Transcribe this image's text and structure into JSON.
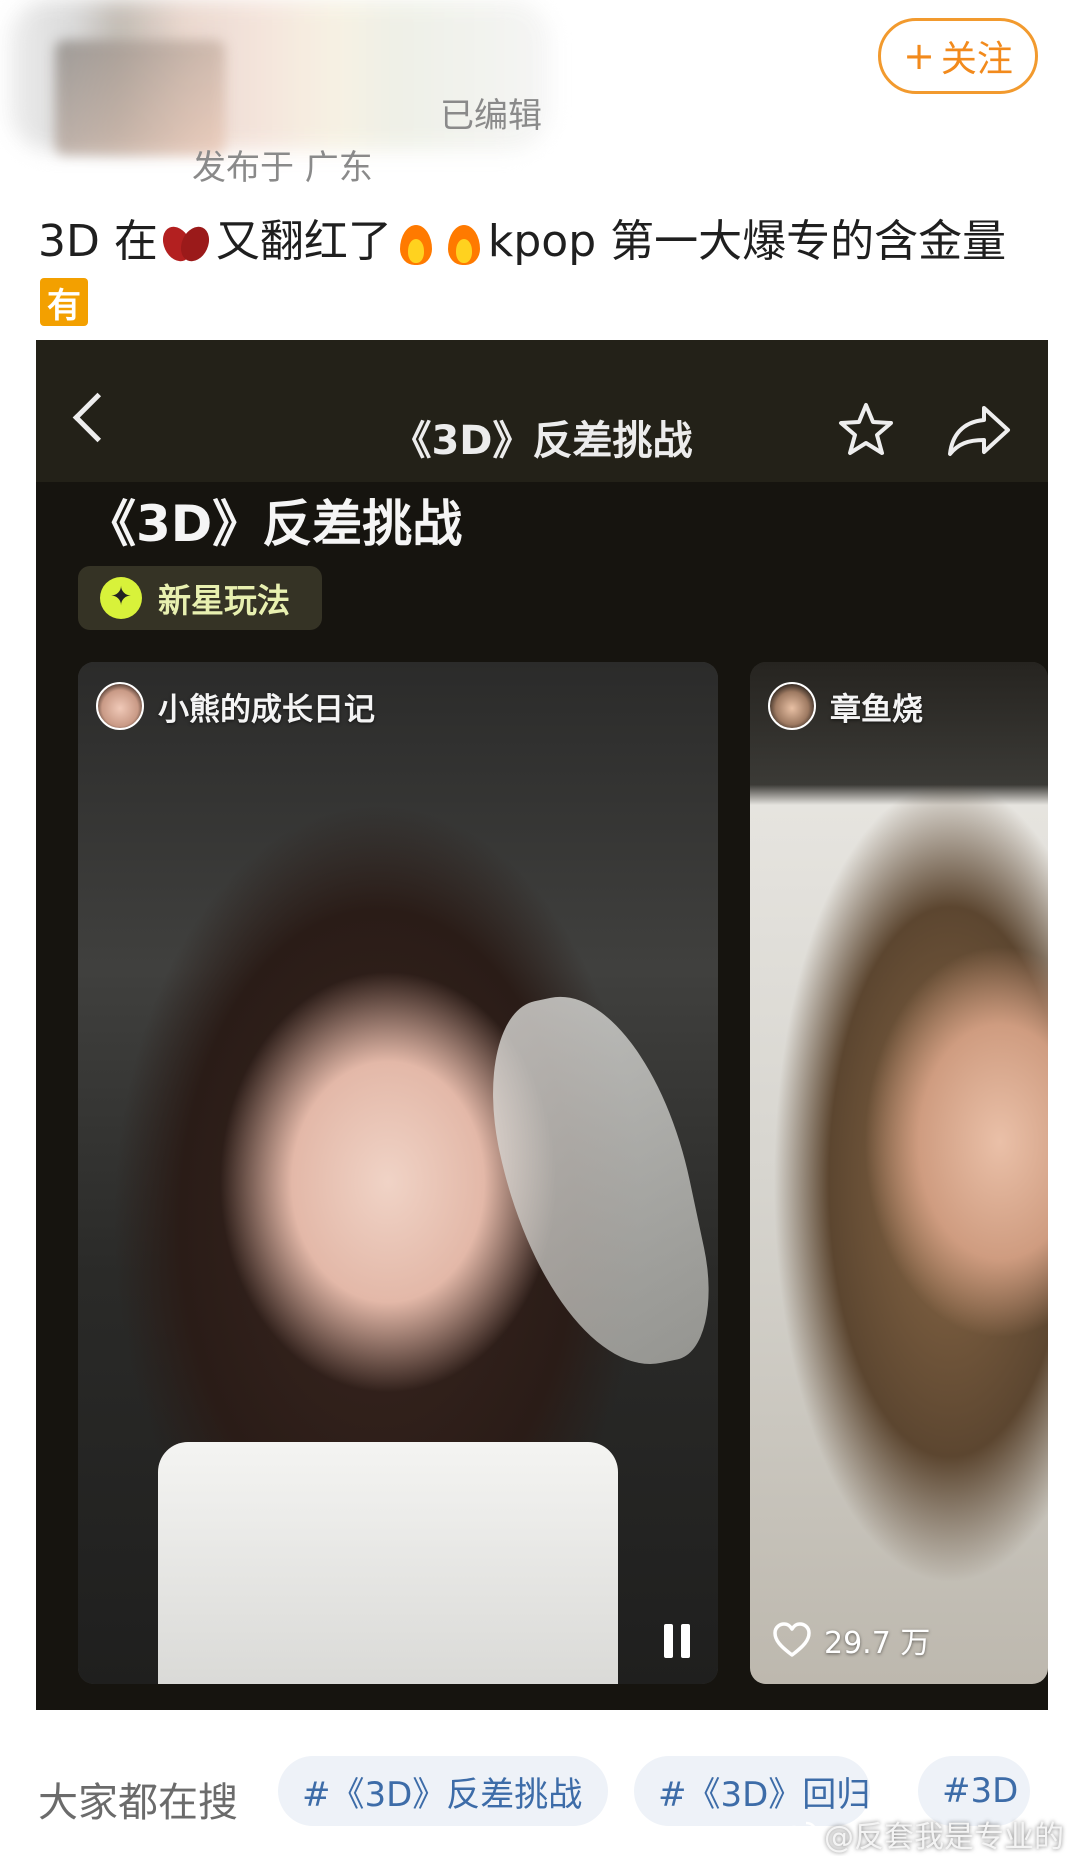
{
  "header": {
    "edited_label": "已编辑",
    "location_label": "发布于 广东",
    "follow_label": "关注",
    "follow_plus": "+"
  },
  "post": {
    "segments": [
      "3D 在",
      "又翻红了",
      "kpop 第一大爆专的含金量"
    ],
    "emoji_icons": [
      "red-bean-icon",
      "fire-icon",
      "fire-icon"
    ],
    "badge": "有"
  },
  "embedded_page": {
    "topbar_title": "《3D》反差挑战",
    "page_title": "《3D》反差挑战",
    "tag": "新星玩法",
    "cards": [
      {
        "author": "小熊的成长日记"
      },
      {
        "author": "章鱼烧",
        "likes": "29.7 万"
      }
    ]
  },
  "search": {
    "label": "大家都在搜",
    "chips": [
      "#《3D》反差挑战",
      "#《3D》回归",
      "#3D"
    ]
  },
  "watermark": "@反套我是专业的",
  "colors": {
    "accent": "#f28a1c",
    "chip_text": "#3d6ca8",
    "chip_bg": "#eef2f8",
    "screenshot_bg": "#16140f",
    "tag_icon": "#d8f23a"
  }
}
